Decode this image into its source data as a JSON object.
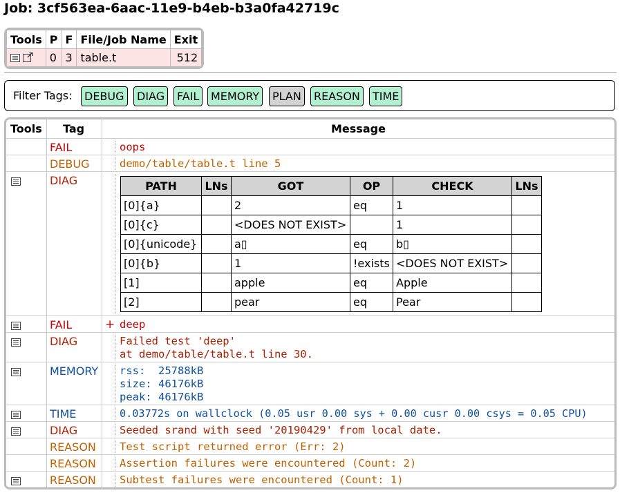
{
  "job_title": "Job: 3cf563ea-6aac-11e9-b4eb-b3a0fa42719c",
  "jobs_table": {
    "headers": [
      "Tools",
      "P",
      "F",
      "File/Job Name",
      "Exit"
    ],
    "rows": [
      {
        "p": "0",
        "f": "3",
        "name": "table.t",
        "exit": "512"
      }
    ]
  },
  "filter": {
    "label": "Filter Tags:",
    "tags": [
      {
        "label": "DEBUG",
        "active": true
      },
      {
        "label": "DIAG",
        "active": true
      },
      {
        "label": "FAIL",
        "active": true
      },
      {
        "label": "MEMORY",
        "active": true
      },
      {
        "label": "PLAN",
        "active": false
      },
      {
        "label": "REASON",
        "active": true
      },
      {
        "label": "TIME",
        "active": true
      }
    ]
  },
  "events": {
    "headers": {
      "tools": "Tools",
      "tag": "Tag",
      "message": "Message"
    },
    "rows": [
      {
        "tag": "FAIL",
        "message": "oops"
      },
      {
        "tag": "DEBUG",
        "message": "demo/table/table.t line 5"
      },
      {
        "tag": "DIAG"
      },
      {
        "tag": "FAIL",
        "message": "deep",
        "marker": "+"
      },
      {
        "tag": "DIAG",
        "message": "Failed test 'deep'\nat demo/table/table.t line 30."
      },
      {
        "tag": "MEMORY",
        "message": "rss:  25788kB\nsize: 46176kB\npeak: 46176kB"
      },
      {
        "tag": "TIME",
        "message": "0.03772s on wallclock (0.05 usr 0.00 sys + 0.00 cusr 0.00 csys = 0.05 CPU)"
      },
      {
        "tag": "DIAG",
        "message": "Seeded srand with seed '20190429' from local date."
      },
      {
        "tag": "REASON",
        "message": "Test script returned error (Err: 2)"
      },
      {
        "tag": "REASON",
        "message": "Assertion failures were encountered (Count: 2)"
      },
      {
        "tag": "REASON",
        "message": "Subtest failures were encountered (Count: 1)"
      }
    ]
  },
  "diag_table": {
    "headers": [
      "PATH",
      "LNs",
      "GOT",
      "OP",
      "CHECK",
      "LNs"
    ],
    "rows": [
      [
        "[0]{a}",
        "",
        "2",
        "eq",
        "1",
        ""
      ],
      [
        "[0]{c}",
        "",
        "<DOES NOT EXIST>",
        "",
        "1",
        ""
      ],
      [
        "[0]{unicode}",
        "",
        "a▯",
        "eq",
        "b▯",
        ""
      ],
      [
        "[0]{b}",
        "",
        "1",
        "!exists",
        "<DOES NOT EXIST>",
        ""
      ],
      [
        "[1]",
        "",
        "apple",
        "eq",
        "Apple",
        ""
      ],
      [
        "[2]",
        "",
        "pear",
        "eq",
        "Pear",
        ""
      ]
    ]
  },
  "colors": {
    "tag_active": "#b2f0d2",
    "tag_inactive": "#d3d3d3",
    "fail_row": "#fde4e4",
    "fail": "#cc0000",
    "debug": "#c06000",
    "diag": "#b02000",
    "memory": "#1050a0",
    "reason": "#c06000"
  }
}
